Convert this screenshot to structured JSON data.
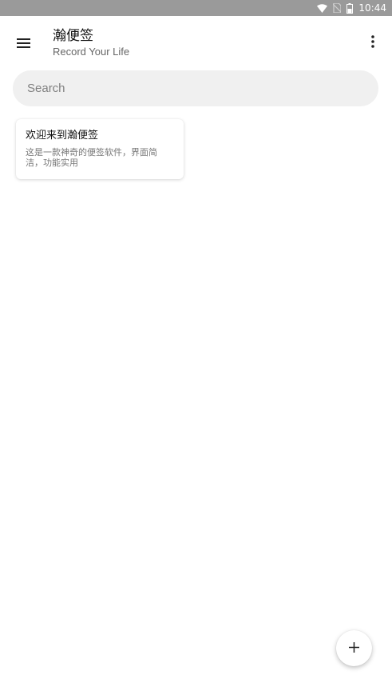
{
  "status_bar": {
    "time": "10:44",
    "icons": [
      "wifi-icon",
      "no-sim-icon",
      "battery-icon"
    ]
  },
  "app_bar": {
    "title": "瀚便签",
    "subtitle": "Record Your Life",
    "menu_icon": "hamburger-menu-icon",
    "more_icon": "more-vert-icon"
  },
  "search": {
    "placeholder": "Search",
    "value": ""
  },
  "notes": [
    {
      "title": "欢迎来到瀚便签",
      "body_line1": "这是一款神奇的便签软件，界面简",
      "body_line2": "洁，功能实用"
    }
  ],
  "fab": {
    "icon": "plus-icon",
    "label": "+"
  }
}
